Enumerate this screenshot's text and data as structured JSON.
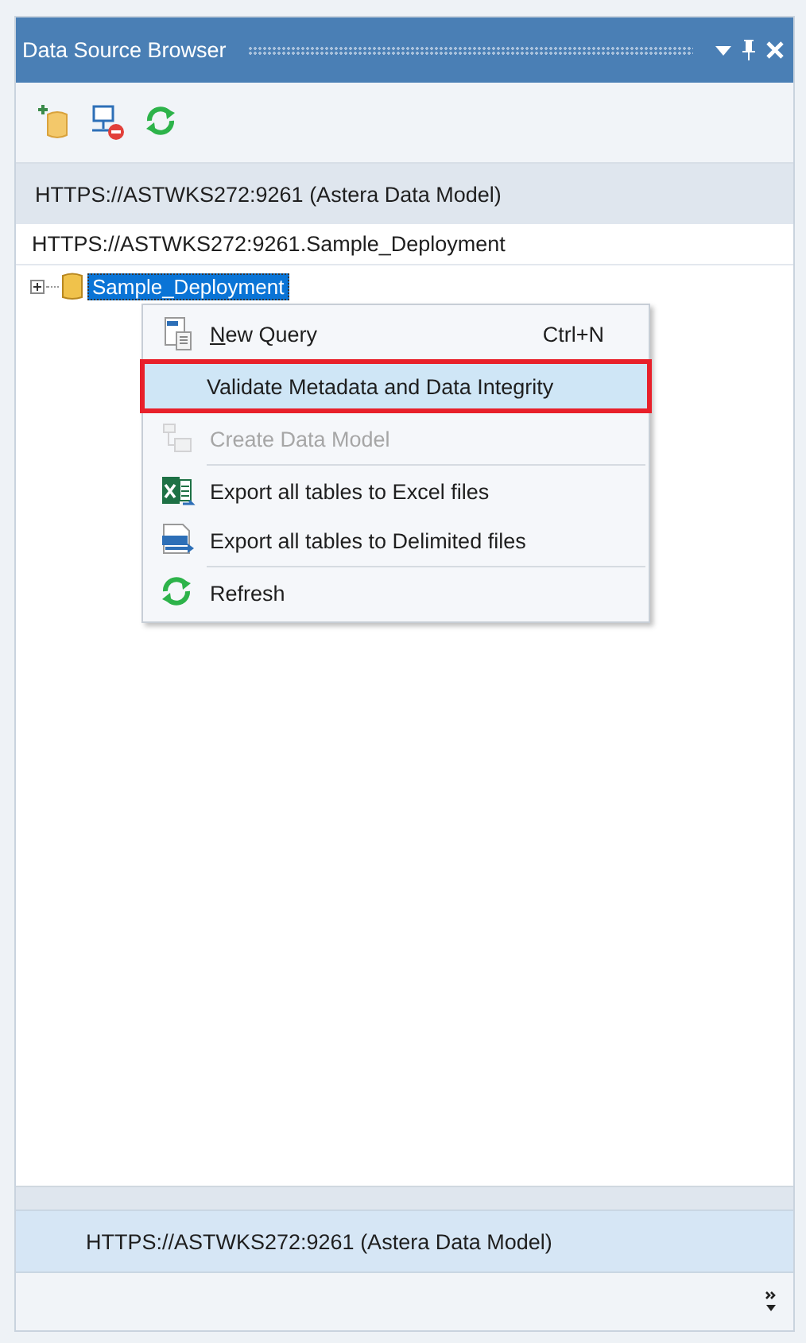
{
  "panel": {
    "title": "Data Source Browser"
  },
  "toolbar": [
    {
      "kind": "add-database"
    },
    {
      "kind": "disconnect"
    },
    {
      "kind": "refresh"
    }
  ],
  "server_header": "HTTPS://ASTWKS272:9261 (Astera Data Model)",
  "path": "HTTPS://ASTWKS272:9261.Sample_Deployment",
  "tree": [
    {
      "label": "Sample_Deployment",
      "selected": true,
      "expanded": false
    }
  ],
  "context_menu": [
    {
      "kind": "query",
      "label": "New Query",
      "shortcut": "Ctrl+N",
      "disabled": false,
      "highlighted": false
    },
    {
      "kind": "validate",
      "label": "Validate Metadata and Data Integrity",
      "disabled": false,
      "highlighted": true
    },
    {
      "kind": "model",
      "label": "Create Data Model",
      "disabled": true,
      "highlighted": false
    },
    {
      "kind": "separator"
    },
    {
      "kind": "excel",
      "label": "Export all tables to Excel files",
      "disabled": false,
      "highlighted": false
    },
    {
      "kind": "csv",
      "label": "Export all tables to Delimited files",
      "disabled": false,
      "highlighted": false
    },
    {
      "kind": "separator"
    },
    {
      "kind": "refresh",
      "label": "Refresh",
      "disabled": false,
      "highlighted": false
    }
  ],
  "footer_connection": "HTTPS://ASTWKS272:9261 (Astera Data Model)"
}
